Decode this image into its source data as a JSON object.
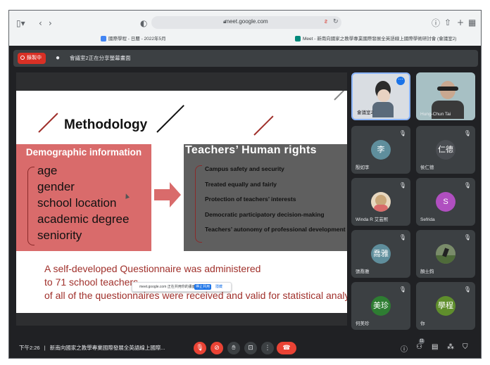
{
  "browser": {
    "url": "meet.google.com",
    "tabs": [
      {
        "label": "國際學程 - 日曆 - 2022年5月",
        "fav_color": "#4285f4"
      },
      {
        "label": "Meet - 新南向國家之教學專業國際發展全英語線上國際學術研討會 (會議室2)",
        "fav_color": "#00897b"
      }
    ],
    "icons": {
      "sidebar": "sidebar-icon",
      "back": "back-icon",
      "forward": "forward-icon",
      "shield": "shield-icon",
      "download": "download-icon",
      "share": "share-icon",
      "new_tab": "plus-icon",
      "tabs_overview": "grid-icon"
    }
  },
  "meet_top": {
    "rec_label": "錄製中",
    "presenting_text": "會議室2正在分享螢幕畫面"
  },
  "slide": {
    "title": "Methodology",
    "demographic": {
      "heading": "Demographic information",
      "items": [
        "age",
        "gender",
        "school location",
        "academic degree",
        "seniority"
      ]
    },
    "rights": {
      "heading": "Teachers’ Human rights",
      "items": [
        "Campus safety and security",
        "Treated equally and fairly",
        "Protection of teachers’ interests",
        "Democratic participatory decision-making",
        "Teachers’ autonomy of professional development"
      ]
    },
    "bottom_lines": [
      "A self-developed Questionnaire was administered",
      "to 71 school teachers",
      "of all of the questionnaires were received and valid for statistical analyse"
    ],
    "colors": {
      "accent_red": "#d96b6b",
      "dark_gray": "#5f5f5f",
      "text_red": "#a0302b"
    }
  },
  "share_pill": {
    "text": "meet.google.com 正在共用你的畫面。",
    "stop_label": "停止共用",
    "hide_label": "隱藏"
  },
  "participants": [
    {
      "name": "會議室2",
      "type": "video"
    },
    {
      "name": "Hung-Chun Tai",
      "type": "video"
    },
    {
      "name": "殷如李",
      "avatar": "李",
      "color": "#5f8e9c"
    },
    {
      "name": "侯仁德",
      "avatar": "仁德",
      "color": "#4a4d52"
    },
    {
      "name": "Winda R 艾芸熙",
      "avatar": "",
      "color": "#c9a77a"
    },
    {
      "name": "Sefrida",
      "avatar": "S",
      "color": "#b04fc0"
    },
    {
      "name": "張喬雅",
      "avatar": "喬雅",
      "color": "#5f8e9c"
    },
    {
      "name": "顏士鈞",
      "avatar": "",
      "color": "#7a8c6a"
    },
    {
      "name": "何美珍",
      "avatar": "美珍",
      "color": "#2e7d32"
    },
    {
      "name": "你",
      "avatar": "學程",
      "color": "#5f8e2c"
    }
  ],
  "bottom_bar": {
    "time": "下午2:26",
    "separator": "|",
    "meeting_title": "新南向國家之教學專業國際發展全英語線上國際...",
    "participant_count": "11"
  }
}
